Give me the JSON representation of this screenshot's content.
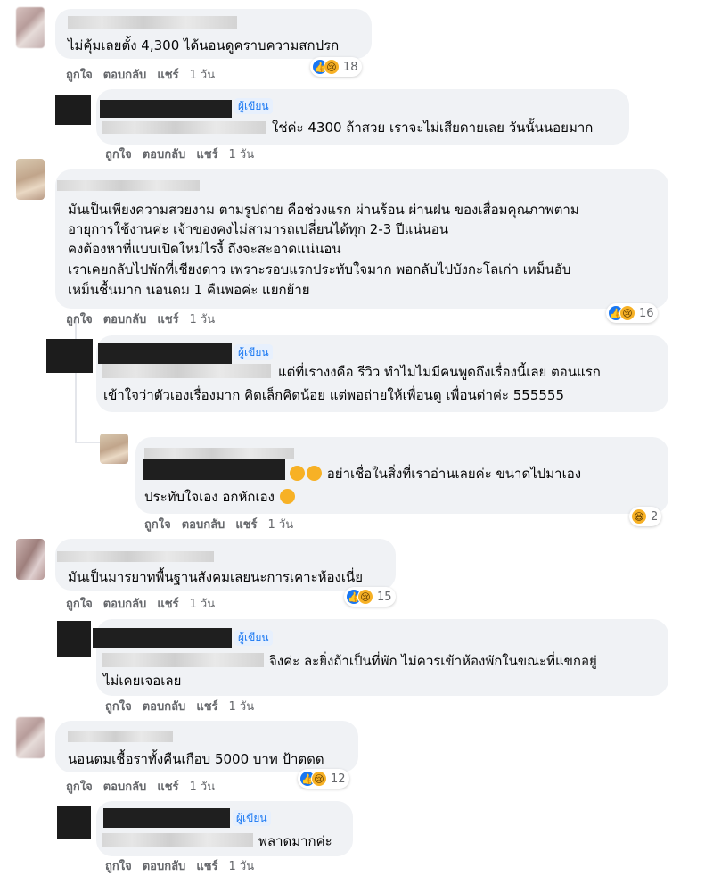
{
  "labels": {
    "like": "ถูกใจ",
    "reply": "ตอบกลับ",
    "share": "แชร์",
    "time": "1 วัน",
    "author": "ผู้เขียน"
  },
  "comments": [
    {
      "lines": [
        "ไม่คุ้มเลยตั้ง 4,300 ได้นอนดูคราบความสกปรก"
      ],
      "reactions": "18"
    },
    {
      "lines": [
        "ใช่ค่ะ 4300 ถ้าสวย เราจะไม่เสียดายเลย วันนั้นนอยมาก"
      ]
    },
    {
      "lines": [
        "มันเป็นเพียงความสวยงาม ตามรูปถ่าย คือช่วงแรก ผ่านร้อน ผ่านฝน ของเสื่อมคุณภาพตาม",
        "อายุการใช้งานค่ะ เจ้าของคงไม่สามารถเปลี่ยนได้ทุก 2-3 ปีแน่นอน",
        "คงต้องหาที่แบบเปิดใหม่ไรงี้ ถึงจะสะอาดแน่นอน",
        "เราเคยกลับไปพักที่เชียงดาว เพราะรอบแรกประทับใจมาก พอกลับไปบังกะโลเก่า เหม็นอับ",
        "เหม็นชื้นมาก นอนดม 1 คืนพอค่ะ แยกย้าย"
      ],
      "reactions": "16"
    },
    {
      "lines": [
        "แต่ที่เรางงคือ รีวิว ทำไมไม่มีคนพูดถึงเรื่องนี้เลย ตอนแรก",
        "เข้าใจว่าตัวเองเรื่องมาก คิดเล็กคิดน้อย แต่พอถ่ายให้เพื่อนดู เพื่อนด่าค่ะ 555555"
      ]
    },
    {
      "lines": [
        "อย่าเชื่อในสิ่งที่เราอ่านเลยค่ะ ขนาดไปมาเอง",
        "ประทับใจเอง อกหักเอง"
      ],
      "reactions": "2"
    },
    {
      "lines": [
        "มันเป็นมารยาทพื้นฐานสังคมเลยนะการเคาะห้องเนี่ย"
      ],
      "reactions": "15"
    },
    {
      "lines": [
        "จิงค่ะ ละยิ่งถ้าเป็นที่พัก ไม่ควรเข้าห้องพักในขณะที่แขกอยู่",
        "ไม่เคยเจอเลย"
      ]
    },
    {
      "lines": [
        "นอนดมเชื้อราทั้งคืนเกือบ 5000 บาท ป้าตดด"
      ],
      "reactions": "12"
    },
    {
      "lines": [
        "พลาดมากค่ะ"
      ]
    }
  ],
  "colors": {
    "bubble": "#f0f2f5",
    "author_badge": "#1877f2",
    "like_blue": "#1877f2",
    "emoji_yellow": "#f7b125",
    "meta_gray": "#65676b"
  },
  "icons": [
    "like-icon",
    "sad-icon",
    "haha-icon"
  ]
}
